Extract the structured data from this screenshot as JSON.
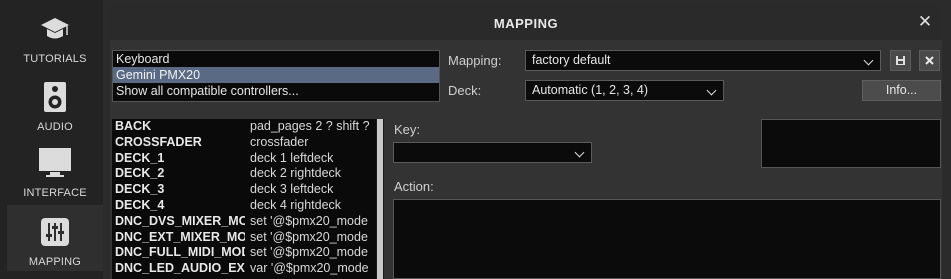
{
  "sidebar": {
    "items": [
      {
        "label": "TUTORIALS",
        "icon": "graduation-cap-icon"
      },
      {
        "label": "AUDIO",
        "icon": "speaker-icon"
      },
      {
        "label": "INTERFACE",
        "icon": "monitor-icon"
      },
      {
        "label": "MAPPING",
        "icon": "sliders-icon",
        "active": true
      }
    ]
  },
  "dialog": {
    "title": "MAPPING",
    "close_icon": "close-icon"
  },
  "controllers": {
    "items": [
      {
        "label": "Keyboard",
        "selected": false
      },
      {
        "label": "Gemini PMX20",
        "selected": true
      },
      {
        "label": "Show all compatible controllers...",
        "selected": false
      }
    ]
  },
  "mapping_field": {
    "label": "Mapping:",
    "value": "factory default",
    "save_icon": "save-icon",
    "delete_icon": "delete-icon"
  },
  "deck_field": {
    "label": "Deck:",
    "value": "Automatic (1, 2, 3, 4)"
  },
  "info_button": {
    "label": "Info..."
  },
  "key_field": {
    "label": "Key:",
    "value": ""
  },
  "action_field": {
    "label": "Action:"
  },
  "mappings": [
    {
      "key": "BACK",
      "action": "pad_pages 2 ? shift ?"
    },
    {
      "key": "CROSSFADER",
      "action": "crossfader"
    },
    {
      "key": "DECK_1",
      "action": "deck 1 leftdeck"
    },
    {
      "key": "DECK_2",
      "action": "deck 2 rightdeck"
    },
    {
      "key": "DECK_3",
      "action": "deck 3 leftdeck"
    },
    {
      "key": "DECK_4",
      "action": "deck 4 rightdeck"
    },
    {
      "key": "DNC_DVS_MIXER_MODE",
      "action": "set '@$pmx20_mode"
    },
    {
      "key": "DNC_EXT_MIXER_MODE",
      "action": "set '@$pmx20_mode"
    },
    {
      "key": "DNC_FULL_MIDI_MODE",
      "action": "set '@$pmx20_mode"
    },
    {
      "key": "DNC_LED_AUDIO_EXT",
      "action": "var '@$pmx20_mode"
    }
  ],
  "colors": {
    "selection": "#5a6a85",
    "background": "#333333",
    "titlebar": "#2a2a2a"
  }
}
